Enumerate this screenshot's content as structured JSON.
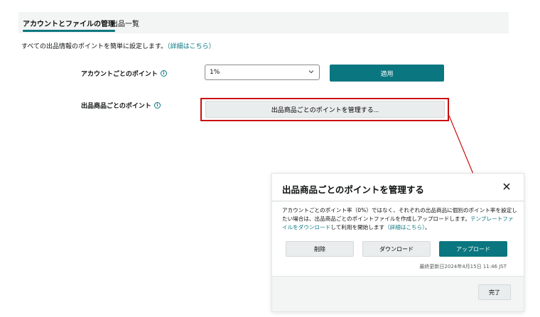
{
  "tabs": [
    {
      "label": "アカウントとファイルの管理",
      "active": true
    },
    {
      "label": "出品一覧",
      "active": false
    }
  ],
  "intro": {
    "text": "すべての出品情報のポイントを簡単に設定します。",
    "link": "（詳細はこちら）"
  },
  "account_points": {
    "label": "アカウントごとのポイント",
    "selected": "1%",
    "apply_label": "適用"
  },
  "listing_points": {
    "label": "出品商品ごとのポイント",
    "manage_label": "出品商品ごとのポイントを管理する..."
  },
  "modal": {
    "title": "出品商品ごとのポイントを管理する",
    "body_text": "アカウントごとのポイント率（0%）ではなく、それぞれの出品商品に個別のポイント率を設定したい場合は、出品商品ごとのポイントファイルを作成しアップロードします。",
    "template_link": "テンプレートファイルをダウンロード",
    "body_suffix": "して利用を開始します",
    "detail_link": "（詳細はこちら）",
    "body_end": "。",
    "delete_label": "削除",
    "download_label": "ダウンロード",
    "upload_label": "アップロード",
    "last_updated": "最終更新日2024年4月15日 11:46 JST",
    "done_label": "完了"
  },
  "colors": {
    "teal": "#0a7680",
    "highlight_red": "#cc0c0c"
  },
  "icons": {
    "info": "info-circle-icon",
    "chevron": "chevron-down-icon",
    "close": "close-icon"
  }
}
